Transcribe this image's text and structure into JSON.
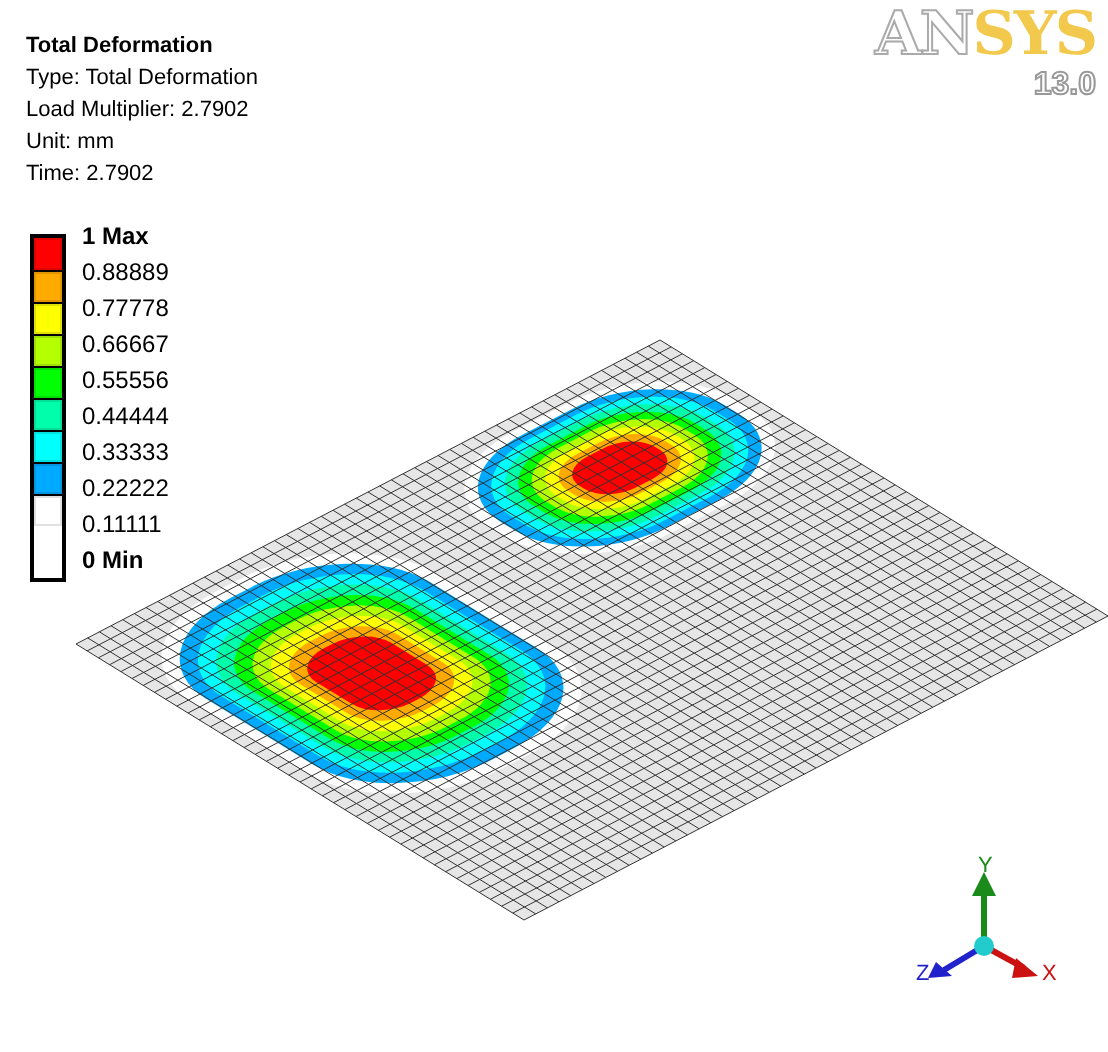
{
  "result": {
    "title": "Total Deformation",
    "details": [
      "Type: Total Deformation",
      "Load Multiplier: 2.7902",
      "Unit: mm",
      "Time: 2.7902"
    ]
  },
  "legend": {
    "labels": [
      "1 Max",
      "0.88889",
      "0.77778",
      "0.66667",
      "0.55556",
      "0.44444",
      "0.33333",
      "0.22222",
      "0.11111",
      "0 Min"
    ],
    "bands": [
      {
        "color": "#ff0000"
      },
      {
        "color": "#ffaa00"
      },
      {
        "color": "#ffff00"
      },
      {
        "color": "#b4ff00"
      },
      {
        "color": "#00ff00"
      },
      {
        "color": "#00ffaa"
      },
      {
        "color": "#00ffff"
      },
      {
        "color": "#00aaff"
      },
      {
        "color": "#ffffff"
      }
    ]
  },
  "logo": {
    "wordmark": "ANSYS",
    "version": "13.0"
  },
  "triad": {
    "x_label": "X",
    "y_label": "Y",
    "z_label": "Z"
  }
}
